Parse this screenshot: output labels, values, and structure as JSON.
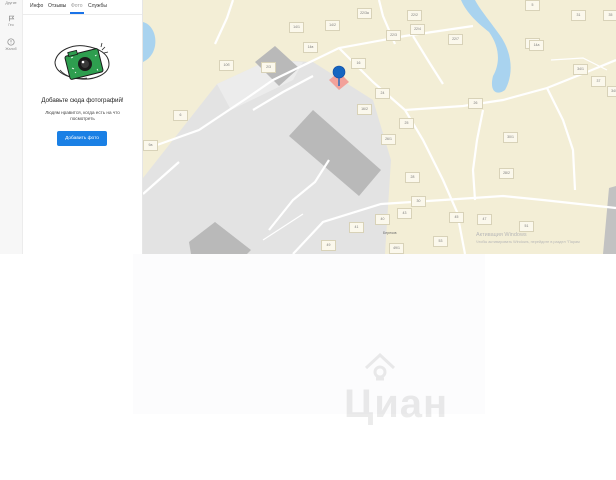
{
  "rail": {
    "items": [
      {
        "label": "Другие",
        "icon": "dots-icon"
      },
      {
        "label": "Гео",
        "icon": "flag-icon"
      },
      {
        "label": "Жалоб",
        "icon": "complaint-icon"
      }
    ]
  },
  "panel": {
    "tabs": [
      {
        "label": "Инфо",
        "active": false
      },
      {
        "label": "Отзывы",
        "active": false
      },
      {
        "label": "Фото",
        "active": true
      },
      {
        "label": "Службы",
        "active": false
      }
    ],
    "empty_state": {
      "title": "Добавьте сюда фотографий!",
      "text": "Людям нравится, когда есть на что посмотреть",
      "button_label": "Добавить фото",
      "illustration": "camera-photo-icon",
      "illustration_color": "#2e9e4f"
    },
    "accent_color": "#1a80e5"
  },
  "map": {
    "background_color": "#f3eed6",
    "water_color": "#a9d3ef",
    "marker_color": "#1565c0",
    "selected_building_color": "#f2a19a",
    "building_numbers": [
      "14/1",
      "14/2",
      "22/3а",
      "22/3",
      "22/2",
      "22/4",
      "14в",
      "16",
      "22/7",
      "33",
      "10б",
      "16/2",
      "26",
      "31",
      "35",
      "24",
      "34/1",
      "37",
      "34/3",
      "30/1",
      "25",
      "28",
      "26/1",
      "28/2",
      "30",
      "40",
      "41",
      "43",
      "45",
      "47",
      "49",
      "51",
      "53",
      "49/1",
      "6",
      "9а",
      "5",
      "14а",
      "2/3"
    ],
    "streets": [
      "Березов"
    ],
    "watermark": {
      "line1": "Активация Windows",
      "line2": "Чтобы активировать Windows, перейдите в раздел \"Парам"
    }
  },
  "brand_watermark": {
    "text": "Циан",
    "icon": "cian-house-icon"
  }
}
